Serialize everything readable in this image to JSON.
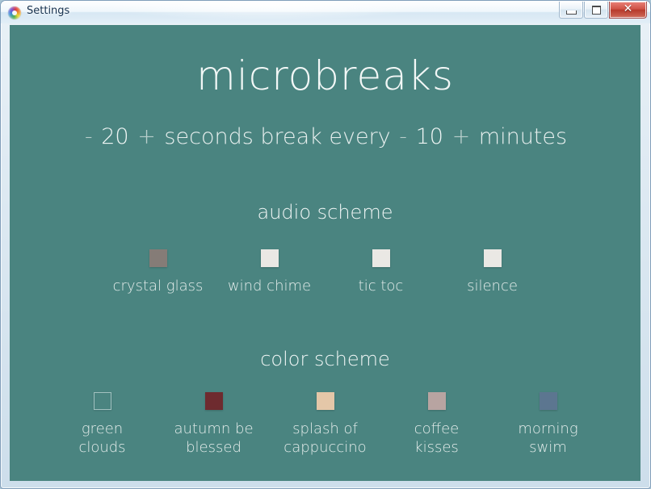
{
  "window": {
    "title": "Settings",
    "icon": "app-logo-icon",
    "controls": {
      "minimize": "minimize-icon",
      "maximize": "maximize-icon",
      "close": "✕"
    }
  },
  "app": {
    "title": "microbreaks",
    "background_color": "#4a8480",
    "subtitle": {
      "decrease_seconds": "-",
      "seconds_value": "20",
      "increase_seconds": "+",
      "seconds_label": "seconds break every",
      "decrease_minutes": "-",
      "minutes_value": "10",
      "increase_minutes": "+",
      "minutes_label": "minutes"
    },
    "audio_section": {
      "heading": "audio scheme",
      "options": [
        {
          "label": "crystal glass",
          "color": "#857c77",
          "selected": true
        },
        {
          "label": "wind chime",
          "color": "#eae8e4",
          "selected": false
        },
        {
          "label": "tic toc",
          "color": "#eae8e4",
          "selected": false
        },
        {
          "label": "silence",
          "color": "#eae8e4",
          "selected": false
        }
      ]
    },
    "color_section": {
      "heading": "color scheme",
      "options": [
        {
          "label": "green\nclouds",
          "color": "#4a8480",
          "selected": true
        },
        {
          "label": "autumn be\nblessed",
          "color": "#6e2b2f",
          "selected": false
        },
        {
          "label": "splash of\ncappuccino",
          "color": "#e4c7a8",
          "selected": false
        },
        {
          "label": "coffee\nkisses",
          "color": "#b8a4a1",
          "selected": false
        },
        {
          "label": "morning\nswim",
          "color": "#5c7690",
          "selected": false
        }
      ]
    }
  }
}
